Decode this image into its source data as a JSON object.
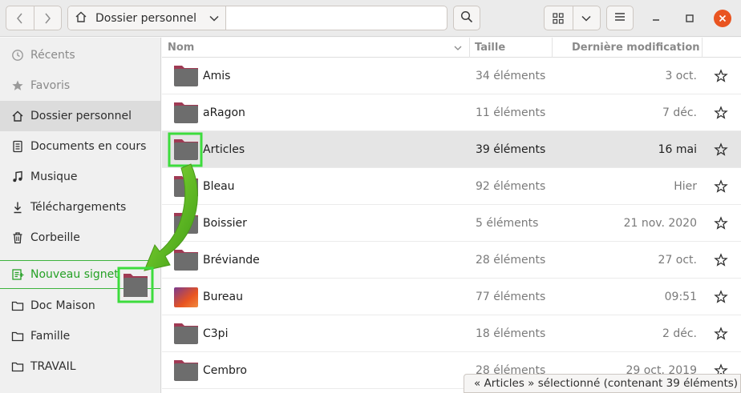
{
  "header": {
    "location": "Dossier personnel",
    "icons": [
      "go-back-icon",
      "go-forward-icon",
      "home-icon",
      "chevron-down-icon",
      "search-icon",
      "grid-view-icon",
      "menu-icon",
      "minimize-icon",
      "maximize-icon",
      "close-icon"
    ]
  },
  "sidebar": {
    "items": [
      {
        "label": "Récents",
        "icon": "clock-icon"
      },
      {
        "label": "Favoris",
        "icon": "star-icon"
      },
      {
        "label": "Dossier personnel",
        "icon": "home-icon"
      },
      {
        "label": "Documents en cours",
        "icon": "document-icon"
      },
      {
        "label": "Musique",
        "icon": "music-icon"
      },
      {
        "label": "Téléchargements",
        "icon": "download-icon"
      },
      {
        "label": "Corbeille",
        "icon": "trash-icon"
      },
      {
        "label": "Nouveau signet",
        "icon": "bookmark-new-icon"
      },
      {
        "label": "Doc Maison",
        "icon": "folder-icon"
      },
      {
        "label": "Famille",
        "icon": "folder-icon"
      },
      {
        "label": "TRAVAIL",
        "icon": "folder-icon"
      }
    ]
  },
  "columns": {
    "name": "Nom",
    "size": "Taille",
    "modified": "Dernière modification"
  },
  "files": [
    {
      "name": "Amis",
      "size": "34 éléments",
      "modified": "3 oct."
    },
    {
      "name": "aRagon",
      "size": "11 éléments",
      "modified": "7 déc."
    },
    {
      "name": "Articles",
      "size": "39 éléments",
      "modified": "16 mai"
    },
    {
      "name": "Bleau",
      "size": "92 éléments",
      "modified": "Hier"
    },
    {
      "name": "Boissier",
      "size": "5 éléments",
      "modified": "21 nov. 2020"
    },
    {
      "name": "Bréviande",
      "size": "28 éléments",
      "modified": "27 oct."
    },
    {
      "name": "Bureau",
      "size": "77 éléments",
      "modified": "09:51"
    },
    {
      "name": "C3pi",
      "size": "18 éléments",
      "modified": "2 déc."
    },
    {
      "name": "Cembro",
      "size": "28 éléments",
      "modified": "29 oct. 2019"
    }
  ],
  "status": {
    "text": "« Articles » sélectionné  (contenant 39 éléments)"
  },
  "colors": {
    "accent": "#e95420",
    "highlight": "#3ddc3d",
    "arrow": "#5cbf1f"
  }
}
